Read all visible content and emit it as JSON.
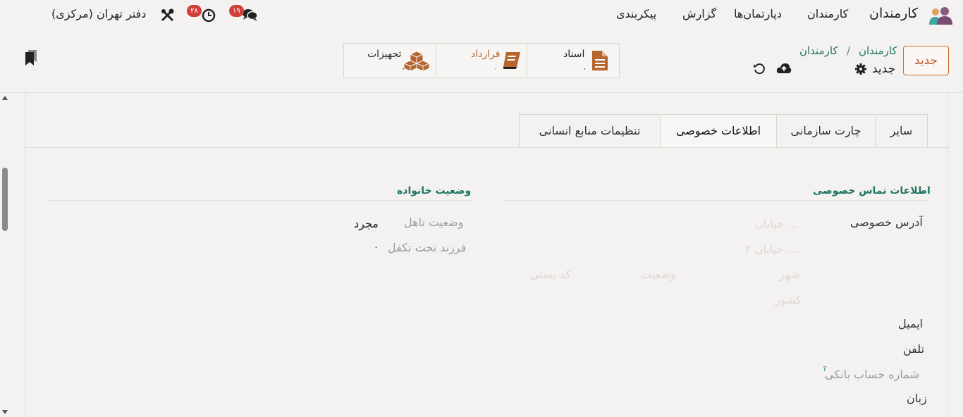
{
  "nav": {
    "app_name": "کارمندان",
    "menu": [
      "کارمندان",
      "دپارتمان‌ها",
      "گزارش",
      "پیکربندی"
    ],
    "messages_count": "۱۹",
    "activities_count": "۲۸",
    "company": "دفتر تهران (مرکزی)"
  },
  "control_panel": {
    "new_button": "جدید",
    "breadcrumb": [
      "کارمندان",
      "کارمندان"
    ],
    "breadcrumb_sep": "/",
    "record_name": "جدید",
    "smart_buttons": [
      {
        "label": "اسناد",
        "count": "۰",
        "icon": "document-icon"
      },
      {
        "label": "قرارداد",
        "count": "۰",
        "icon": "book-icon"
      },
      {
        "label": "تجهیزات",
        "count": "۰",
        "icon": "cubes-icon"
      }
    ]
  },
  "tabs": [
    "سایر",
    "چارت سازمانی",
    "اطلاعات خصوصی",
    "تنظیمات منابع انسانی"
  ],
  "active_tab": "اطلاعات خصوصی",
  "private_contact": {
    "title": "اطلاعات تماس خصوصی",
    "address_label": "آدرس خصوصی",
    "street_ph": "خیابان ...",
    "street2_ph": "خیابان ۲ ...",
    "city_ph": "شهر",
    "state_ph": "وضعیت",
    "zip_ph": "کد پستی",
    "country_ph": "کشور",
    "email_label": "ایمیل",
    "phone_label": "تلفن",
    "bank_label": "شماره حساب بانکی",
    "bank_help": "?",
    "lang_label": "زبان"
  },
  "family": {
    "title": "وضعیت خانواده",
    "marital_label": "وضعیت تاهل",
    "marital_value": "مجرد",
    "children_label": "فرزند تحت تکفل",
    "children_value": "۰"
  },
  "colors": {
    "accent": "#1f7565",
    "brand": "#c0562a",
    "badge": "#d23f3a"
  }
}
